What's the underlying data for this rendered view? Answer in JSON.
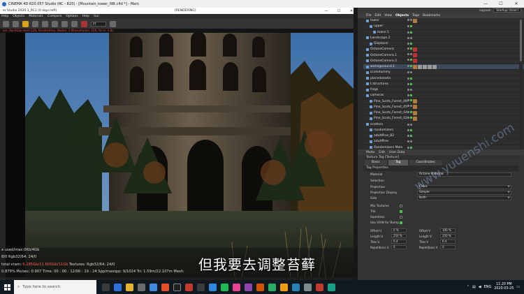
{
  "app_title": "CINEMA 4D R20.057 Studio (RC - R20) - [Mountain_tower_08t.c4d *] - Main",
  "window_controls": {
    "minimize": "—",
    "maximize": "☐",
    "close": "✕"
  },
  "render_window": {
    "title": "er Studio 2020.1_RC1 (0 days left)",
    "mode": "[RENDERING]",
    "menu": [
      "Help",
      "Objects",
      "Materials",
      "Compare",
      "Options",
      "Help",
      "Gui"
    ],
    "status": "ion: RochGas level:128, Rendertime, Nodes: 1 Maxsamples: 256, Gr.m: 1.8s",
    "toolbar_select": "PT"
  },
  "stats": {
    "line1": "e used/max:0Kb/4Gb",
    "line2": "8/0    Rgb32/64: 24/0",
    "line3_a": "total vram: ",
    "line3_b": "6.285Gb/11.605Gb/11Gb",
    "line3_c": "  Textures: Rgb32/64: 24/0",
    "line4": "0.879%   Ms/sec: 0.907   Time: 00 : 00 : 12/00 : 19 : 24   Spp/maxspp: 9/1024   Tri: 1.59m/22.107m   Mesh:"
  },
  "subtitle": "但我要去调整苔藓",
  "watermark": "www.yuuenshi.com",
  "layout": {
    "label": "Layout:",
    "value": "Startup (User)"
  },
  "object_manager": {
    "menu": [
      "File",
      "Edit",
      "View",
      "Objects",
      "Tags",
      "Bookmarks"
    ],
    "active_menu": "Objects",
    "rows": [
      {
        "name": "tower",
        "indent": 0
      },
      {
        "name": "upper",
        "indent": 1
      },
      {
        "name": "tower.1",
        "indent": 2
      },
      {
        "name": "Landscape.2",
        "indent": 0
      },
      {
        "name": "Displacer",
        "indent": 1
      },
      {
        "name": "OctaneCamera",
        "indent": 0
      },
      {
        "name": "OctaneCamera.1",
        "indent": 0
      },
      {
        "name": "OctaneCamera.2",
        "indent": 0
      },
      {
        "name": "walrogoround.1",
        "indent": 0
      },
      {
        "name": "scaledummy",
        "indent": 0
      },
      {
        "name": "placedassets",
        "indent": 0
      },
      {
        "name": "t.structures",
        "indent": 0
      },
      {
        "name": "frogs",
        "indent": 0
      },
      {
        "name": "cameras",
        "indent": 0
      },
      {
        "name": "Pine_Scots_Forest_06",
        "indent": 1
      },
      {
        "name": "Pine_Scots_Forest_05",
        "indent": 1
      },
      {
        "name": "Pine_Scots_Forest_04",
        "indent": 1
      },
      {
        "name": "Pine_Scots_Forest_02",
        "indent": 1
      },
      {
        "name": "scatters",
        "indent": 0
      },
      {
        "name": "randomizers",
        "indent": 1
      },
      {
        "name": "adultPine_B2",
        "indent": 1
      },
      {
        "name": "adultPine",
        "indent": 1
      },
      {
        "name": "Randomizers Main",
        "indent": 1
      }
    ]
  },
  "attribute_manager": {
    "menu": [
      "Mode",
      "Edit",
      "User Data"
    ],
    "header": "Texture Tag [Texture]",
    "tabs": [
      "Basic",
      "Tag",
      "Coordinates"
    ],
    "active_tab": "Tag",
    "section": "Tag Properties",
    "material_label": "Material",
    "material_value": "Octane Material",
    "selection_label": "Selection",
    "fields": [
      {
        "label": "Projection",
        "value": "Cubic"
      },
      {
        "label": "Projection Display",
        "value": "Simple"
      },
      {
        "label": "Side",
        "value": "Both"
      }
    ],
    "checks": [
      {
        "label": "Mix Textures",
        "on": false
      },
      {
        "label": "Tile",
        "on": true
      },
      {
        "label": "Seamless",
        "on": false
      },
      {
        "label": "Use UVW for Bump",
        "on": true
      }
    ],
    "grid": [
      {
        "label": "Offset U",
        "value": "0 %",
        "label2": "Offset V",
        "value2": "100 %"
      },
      {
        "label": "Length U",
        "value": "250 %",
        "label2": "Length V",
        "value2": "250 %"
      },
      {
        "label": "Tiles U",
        "value": "0.4",
        "label2": "Tiles V",
        "value2": "0.4"
      },
      {
        "label": "Repetitions U",
        "value": "0",
        "label2": "Repetitions V",
        "value2": "0"
      }
    ]
  },
  "taskbar": {
    "search_placeholder": "Type here to search",
    "lang": "ENG",
    "time": "11:20 PM",
    "date": "2020-03-25"
  },
  "colors": {
    "accent": "#d8a21b",
    "selected_row": "#3c4a5c",
    "status_red": "#e04040"
  }
}
